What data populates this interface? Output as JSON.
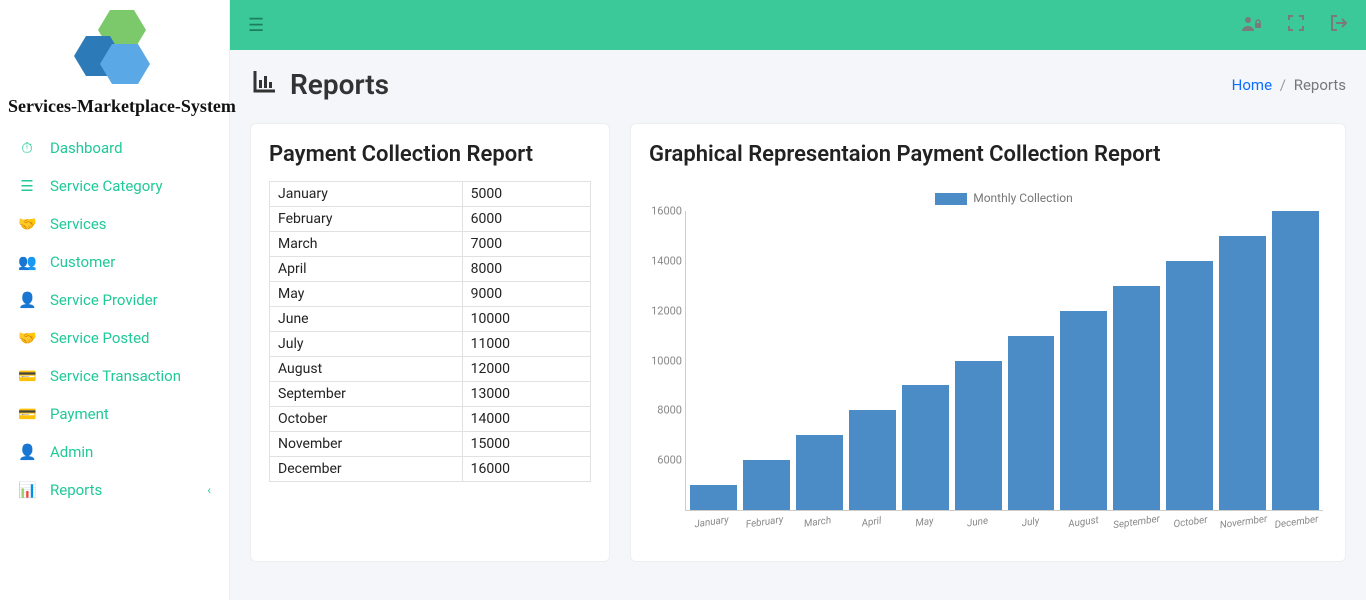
{
  "app": {
    "name": "Services-Marketplace-System"
  },
  "sidebar": {
    "items": [
      {
        "icon": "dashboard-icon",
        "glyph": "⏱",
        "label": "Dashboard"
      },
      {
        "icon": "list-icon",
        "glyph": "☰",
        "label": "Service Category"
      },
      {
        "icon": "handshake-icon",
        "glyph": "🤝",
        "label": "Services"
      },
      {
        "icon": "users-icon",
        "glyph": "👥",
        "label": "Customer"
      },
      {
        "icon": "provider-icon",
        "glyph": "👤",
        "label": "Service Provider"
      },
      {
        "icon": "posted-icon",
        "glyph": "🤝",
        "label": "Service Posted"
      },
      {
        "icon": "transaction-icon",
        "glyph": "💳",
        "label": "Service Transaction"
      },
      {
        "icon": "payment-icon",
        "glyph": "💳",
        "label": "Payment"
      },
      {
        "icon": "admin-icon",
        "glyph": "👤",
        "label": "Admin"
      },
      {
        "icon": "reports-icon",
        "glyph": "📊",
        "label": "Reports",
        "has_sub": true
      }
    ]
  },
  "topbar": {
    "icons": [
      "user-lock-icon",
      "expand-icon",
      "logout-icon"
    ]
  },
  "page": {
    "title": "Reports",
    "breadcrumb_home": "Home",
    "breadcrumb_current": "Reports"
  },
  "table_card": {
    "title": "Payment Collection Report",
    "rows": [
      {
        "month": "January",
        "amount": "5000"
      },
      {
        "month": "February",
        "amount": "6000"
      },
      {
        "month": "March",
        "amount": "7000"
      },
      {
        "month": "April",
        "amount": "8000"
      },
      {
        "month": "May",
        "amount": "9000"
      },
      {
        "month": "June",
        "amount": "10000"
      },
      {
        "month": "July",
        "amount": "11000"
      },
      {
        "month": "August",
        "amount": "12000"
      },
      {
        "month": "September",
        "amount": "13000"
      },
      {
        "month": "October",
        "amount": "14000"
      },
      {
        "month": "November",
        "amount": "15000"
      },
      {
        "month": "December",
        "amount": "16000"
      }
    ]
  },
  "chart_card": {
    "title": "Graphical Representaion Payment Collection Report",
    "legend": "Monthly Collection"
  },
  "chart_data": {
    "type": "bar",
    "categories": [
      "January",
      "February",
      "March",
      "April",
      "May",
      "June",
      "July",
      "August",
      "September",
      "October",
      "Novermber",
      "December"
    ],
    "values": [
      5000,
      6000,
      7000,
      8000,
      9000,
      10000,
      11000,
      12000,
      13000,
      14000,
      15000,
      16000
    ],
    "title": "Graphical Representaion Payment Collection Report",
    "xlabel": "",
    "ylabel": "",
    "series_name": "Monthly Collection",
    "ylim": [
      4000,
      16000
    ],
    "yticks": [
      6000,
      8000,
      10000,
      12000,
      14000,
      16000
    ]
  },
  "colors": {
    "brand": "#3cc999",
    "link": "#20c997",
    "bar": "#4c8cc6"
  }
}
